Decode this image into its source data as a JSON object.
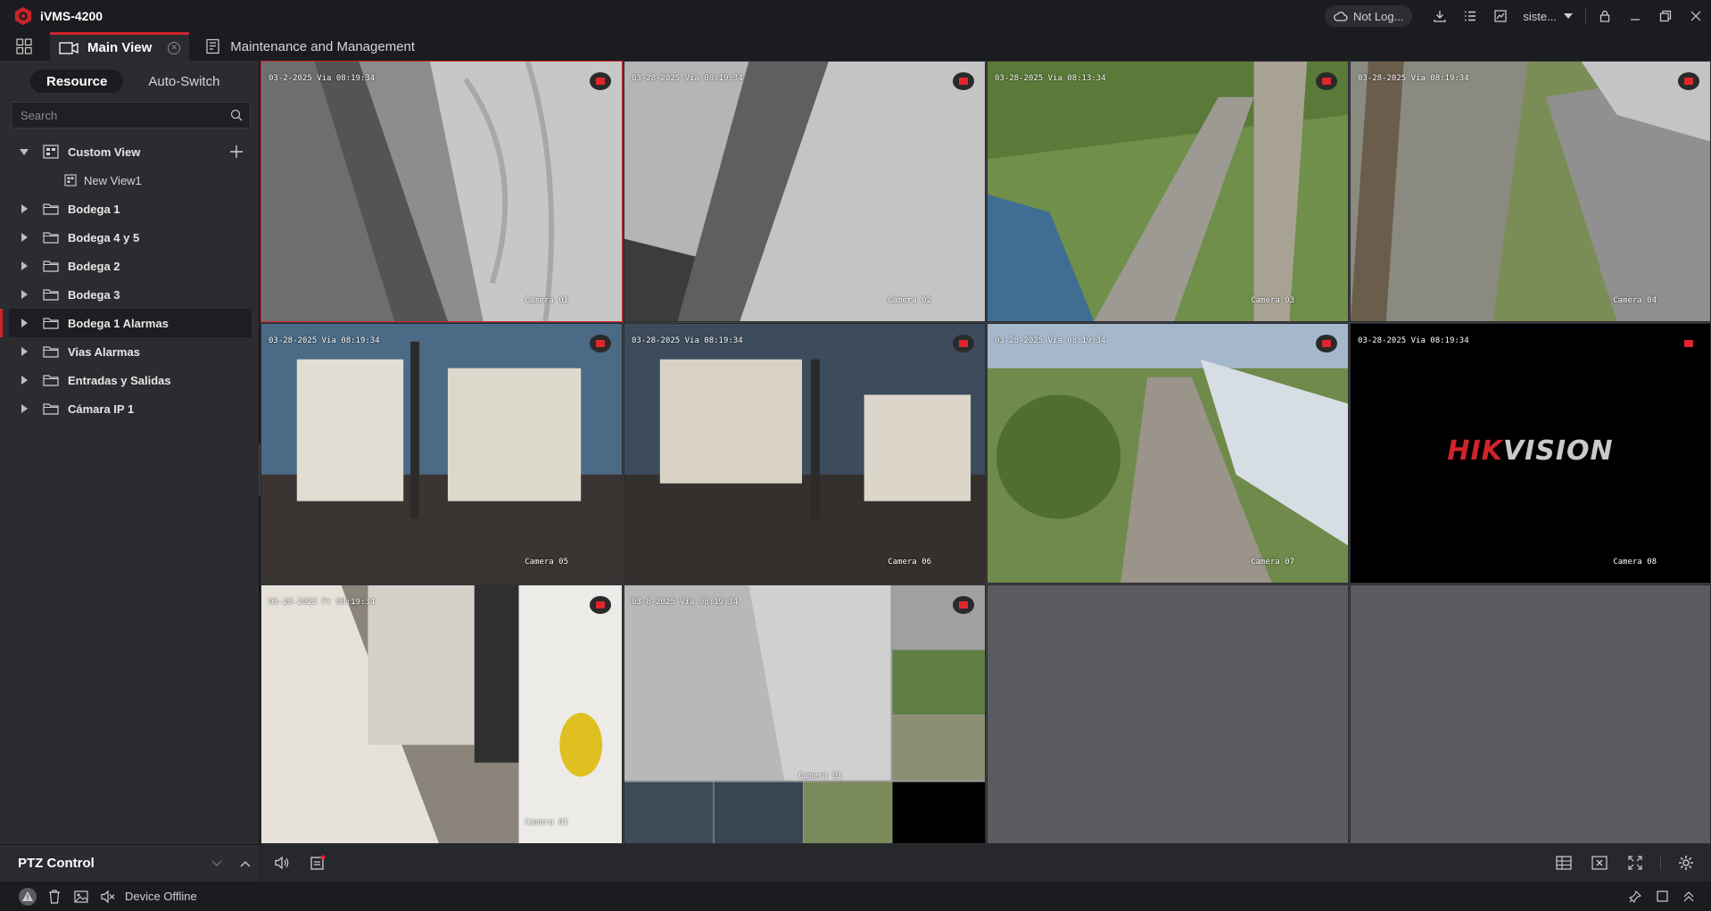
{
  "app": {
    "title": "iVMS-4200"
  },
  "titlebar": {
    "cloud_status": "Not Log...",
    "user": "siste..."
  },
  "tabs": [
    {
      "label": "Main View",
      "active": true
    },
    {
      "label": "Maintenance and Management",
      "active": false
    }
  ],
  "sidebar": {
    "segments": [
      "Resource",
      "Auto-Switch"
    ],
    "active_segment": "Resource",
    "search": {
      "placeholder": "Search",
      "value": ""
    },
    "tree": [
      {
        "label": "Custom View",
        "expanded": true,
        "type": "view-group"
      },
      {
        "label": "New View1",
        "type": "view"
      },
      {
        "label": "Bodega 1",
        "type": "folder"
      },
      {
        "label": "Bodega 4 y 5",
        "type": "folder"
      },
      {
        "label": "Bodega 2",
        "type": "folder"
      },
      {
        "label": "Bodega 3",
        "type": "folder"
      },
      {
        "label": "Bodega 1 Alarmas",
        "type": "folder",
        "selected": true
      },
      {
        "label": "Vias Alarmas",
        "type": "folder"
      },
      {
        "label": "Entradas y Salidas",
        "type": "folder"
      },
      {
        "label": "Cámara IP 1",
        "type": "folder"
      }
    ],
    "ptz": {
      "label": "PTZ Control"
    }
  },
  "video_tiles": [
    {
      "timestamp": "03-2-2025 Via  08:19:34",
      "camera": "Camera 01",
      "scene": "indoor-gray",
      "selected": true,
      "rec": true
    },
    {
      "timestamp": "03-28-2025 Via  08:19:34",
      "camera": "Camera 02",
      "scene": "indoor-gray",
      "rec": true
    },
    {
      "timestamp": "03-28-2025 Via  08:13:34",
      "camera": "Camera 03",
      "scene": "rail-green",
      "rec": true
    },
    {
      "timestamp": "03-28-2025 Via  08:19:34",
      "camera": "Camera 04",
      "scene": "rail-green",
      "rec": true
    },
    {
      "timestamp": "03-28-2025 Via  08:19:34",
      "camera": "Camera 05",
      "scene": "warehouse",
      "rec": true
    },
    {
      "timestamp": "03-28-2025 Via  08:19:34",
      "camera": "Camera 06",
      "scene": "warehouse",
      "rec": true
    },
    {
      "timestamp": "03-28-2025 Via  08:19:34",
      "camera": "Camera 07",
      "scene": "rail-aerial",
      "rec": true
    },
    {
      "timestamp": "03-28-2025 Via  08:19:34",
      "camera": "Camera 08",
      "scene": "hikvision",
      "rec": true
    },
    {
      "timestamp": "03-28-2025 Fr  08:19:34",
      "camera": "Camera 01",
      "scene": "hallway",
      "rec": true
    },
    {
      "timestamp": "03-8-2025 Via  08:19:34",
      "camera": "Camera 01",
      "scene": "mosaic",
      "rec": true
    }
  ],
  "hikvision_logo": {
    "part1": "HIK",
    "part2": "VISION"
  },
  "statusbar": {
    "text": "Device Offline"
  },
  "colors": {
    "accent": "#d0242b",
    "background": "#1b1c1f",
    "panel": "#2b2c30"
  }
}
